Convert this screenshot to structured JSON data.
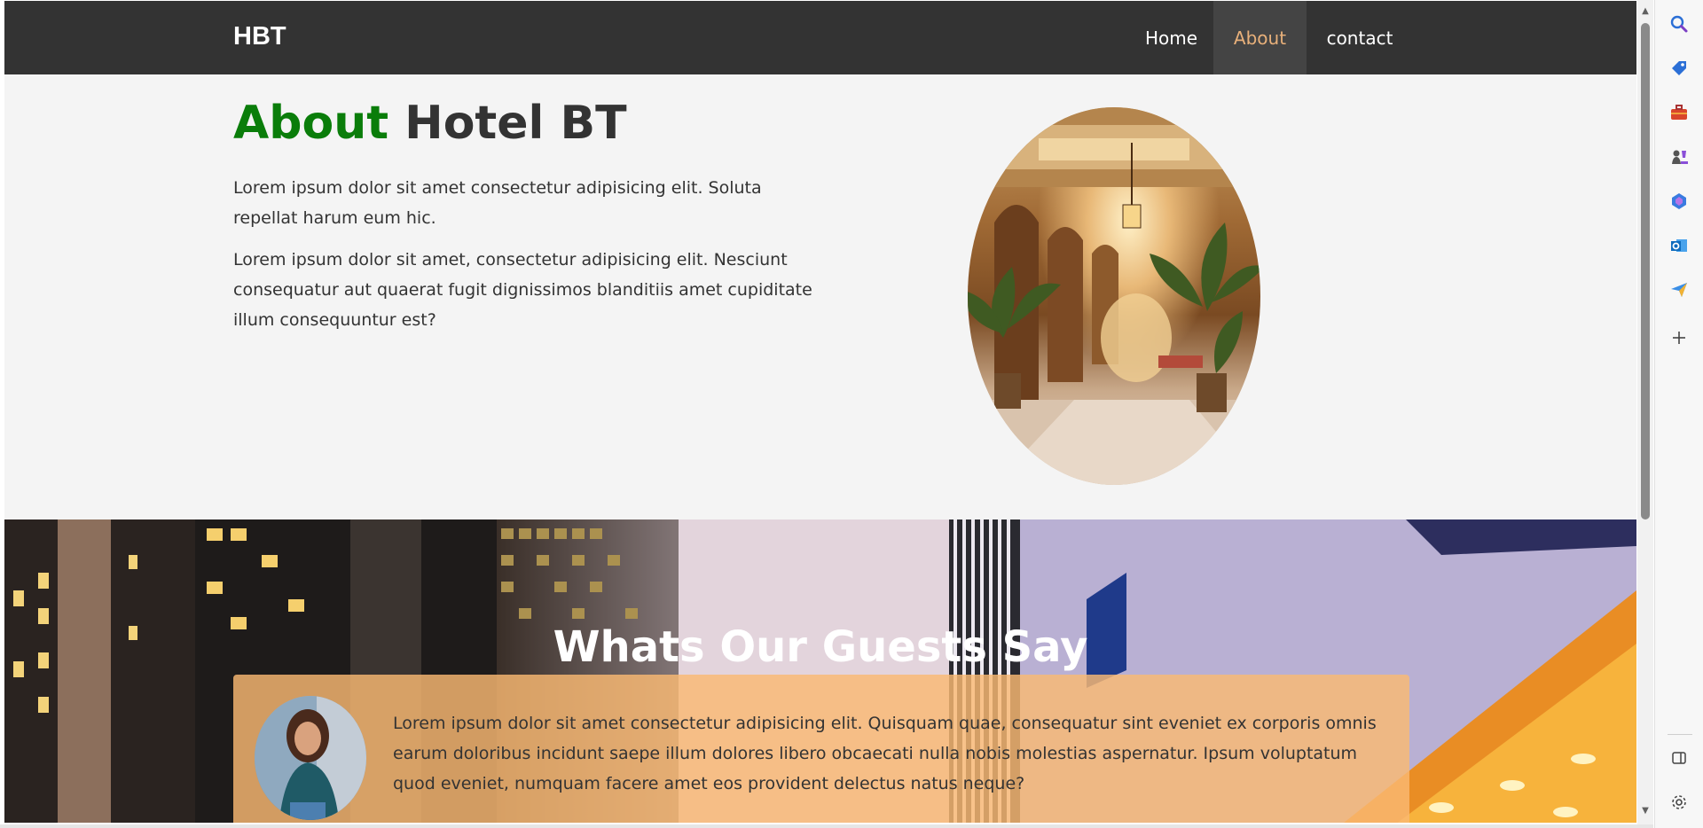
{
  "navbar": {
    "brand": "HBT",
    "items": [
      {
        "label": "Home",
        "active": false
      },
      {
        "label": "About",
        "active": true
      },
      {
        "label": "contact",
        "active": false
      }
    ]
  },
  "about": {
    "title_accent": "About",
    "title_rest": " Hotel BT",
    "paragraphs": [
      "Lorem ipsum dolor sit amet consectetur adipisicing elit. Soluta repellat harum eum hic.",
      "Lorem ipsum dolor sit amet, consectetur adipisicing elit. Nesciunt consequatur aut quaerat fugit dignissimos blanditiis amet cupiditate illum consequuntur est?"
    ]
  },
  "testimonials": {
    "title": "Whats Our Guests Say",
    "items": [
      {
        "text": "Lorem ipsum dolor sit amet consectetur adipisicing elit. Quisquam quae, consequatur sint eveniet ex corporis omnis earum doloribus incidunt saepe illum dolores libero obcaecati nulla nobis molestias aspernatur. Ipsum voluptatum quod eveniet, numquam facere amet eos provident delectus natus neque?"
      }
    ]
  },
  "colors": {
    "navbar_bg": "#333333",
    "active_nav": "#e8b07a",
    "accent_green": "#0a7d0a",
    "card_bg": "#fab973"
  },
  "edge_sidebar": {
    "icons": [
      "search-icon",
      "tag-icon",
      "briefcase-icon",
      "chess-icon",
      "copilot-icon",
      "outlook-icon",
      "send-icon",
      "add-icon",
      "split-view-icon",
      "settings-icon"
    ]
  }
}
